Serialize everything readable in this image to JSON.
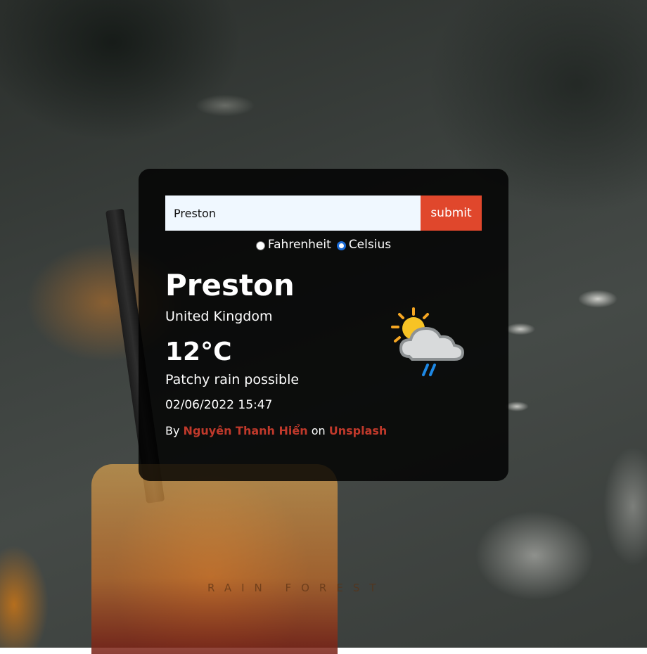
{
  "search": {
    "value": "Preston",
    "submit_label": "submit"
  },
  "units": {
    "fahrenheit_label": "Fahrenheit",
    "celsius_label": "Celsius",
    "selected": "Celsius"
  },
  "weather": {
    "city": "Preston",
    "country": "United Kingdom",
    "temperature": "12°C",
    "condition": "Patchy rain possible",
    "datetime": "02/06/2022 15:47",
    "icon": "sun-cloud-rain-icon"
  },
  "credit": {
    "by": "By",
    "author": "Nguyên Thanh Hiển",
    "on": "on",
    "site": "Unsplash"
  },
  "colors": {
    "accent": "#e0472c",
    "link": "#c0392b",
    "input_bg": "#f0f8ff"
  },
  "background": {
    "glass_text": "RAIN FOREST"
  }
}
